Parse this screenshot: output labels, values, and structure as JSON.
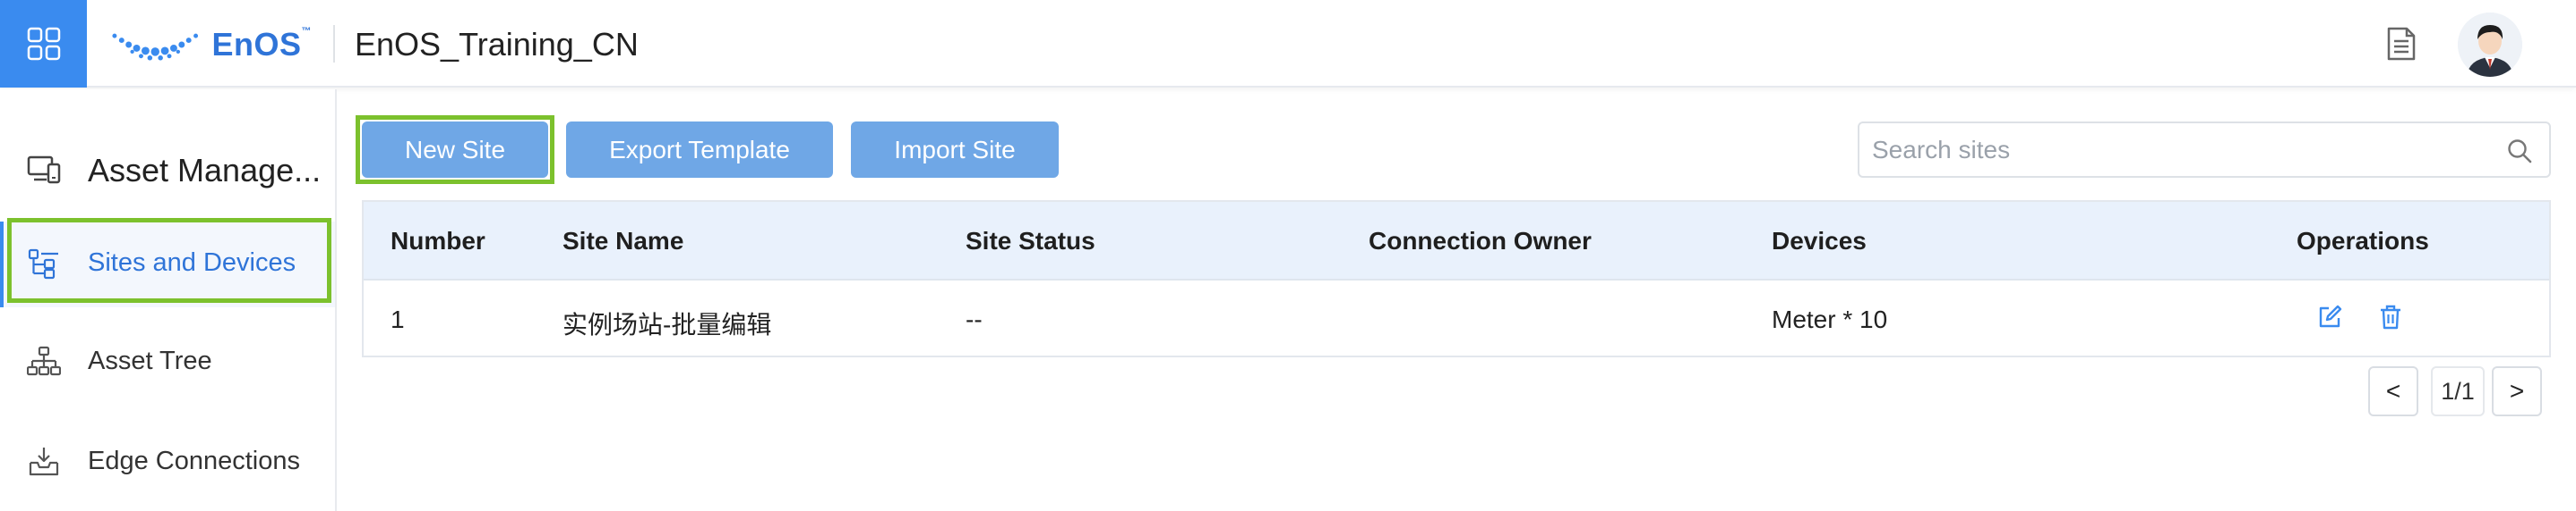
{
  "header": {
    "logo_text": "EnOS",
    "logo_tm": "™",
    "org_title": "EnOS_Training_CN",
    "icons": [
      "app-grid-icon",
      "document-icon",
      "user-avatar"
    ]
  },
  "sidebar": {
    "header_label": "Asset Manage...",
    "items": [
      {
        "label": "Sites and Devices",
        "icon": "site-tree-icon",
        "active": true
      },
      {
        "label": "Asset Tree",
        "icon": "hierarchy-icon",
        "active": false
      },
      {
        "label": "Edge Connections",
        "icon": "inbox-download-icon",
        "active": false
      }
    ]
  },
  "toolbar": {
    "new_site_label": "New Site",
    "export_template_label": "Export Template",
    "import_site_label": "Import Site",
    "search_placeholder": "Search sites"
  },
  "table": {
    "columns": [
      "Number",
      "Site Name",
      "Site Status",
      "Connection Owner",
      "Devices",
      "Operations"
    ],
    "rows": [
      {
        "number": "1",
        "site_name": "实例场站-批量编辑",
        "site_status": "--",
        "connection_owner": "",
        "devices": "Meter * 10"
      }
    ]
  },
  "pagination": {
    "prev_label": "<",
    "page_info": "1/1",
    "next_label": ">"
  },
  "colors": {
    "primary": "#3a8bef",
    "button": "#6fa7e6",
    "highlight": "#7cc12d",
    "table_header_bg": "#e9f1fc"
  }
}
